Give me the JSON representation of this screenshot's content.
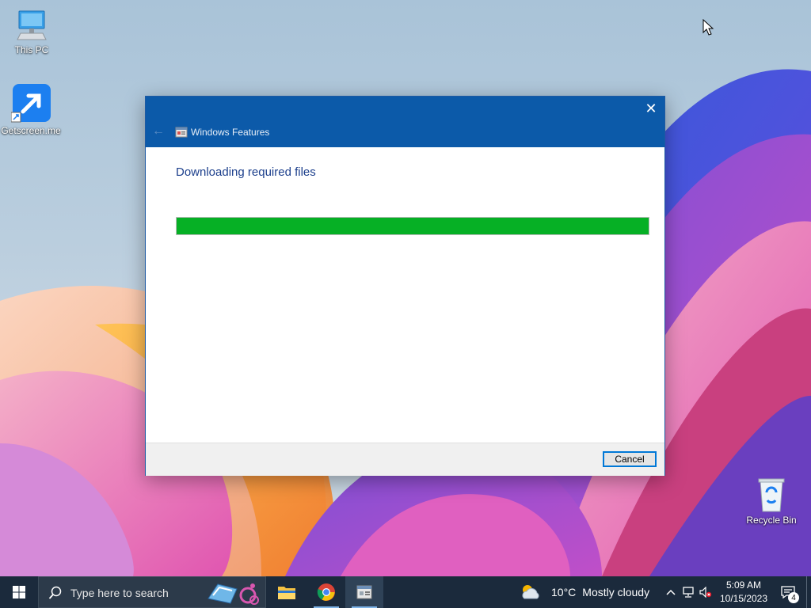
{
  "desktop": {
    "icons": [
      {
        "label": "This PC",
        "icon": "computer-icon"
      },
      {
        "label": "Getscreen.me",
        "icon": "getscreen-icon"
      },
      {
        "label": "Recycle Bin",
        "icon": "recycle-bin-icon"
      }
    ]
  },
  "dialog": {
    "window_title": "Windows Features",
    "heading": "Downloading required files",
    "progress_fraction": 1.0,
    "progress_color": "#06b025",
    "cancel_label": "Cancel",
    "close_glyph": "✕",
    "back_glyph": "←"
  },
  "taskbar": {
    "search_placeholder": "Type here to search",
    "apps": [
      "file-explorer",
      "chrome",
      "windows-features"
    ],
    "weather": {
      "temp": "10°C",
      "condition": "Mostly cloudy"
    },
    "clock": {
      "time": "5:09 AM",
      "date": "10/15/2023"
    },
    "notification_count": "4"
  },
  "colors": {
    "titlebar": "#0c5aa9",
    "taskbar": "#1b2a3c",
    "heading_text": "#1c3f8c"
  }
}
